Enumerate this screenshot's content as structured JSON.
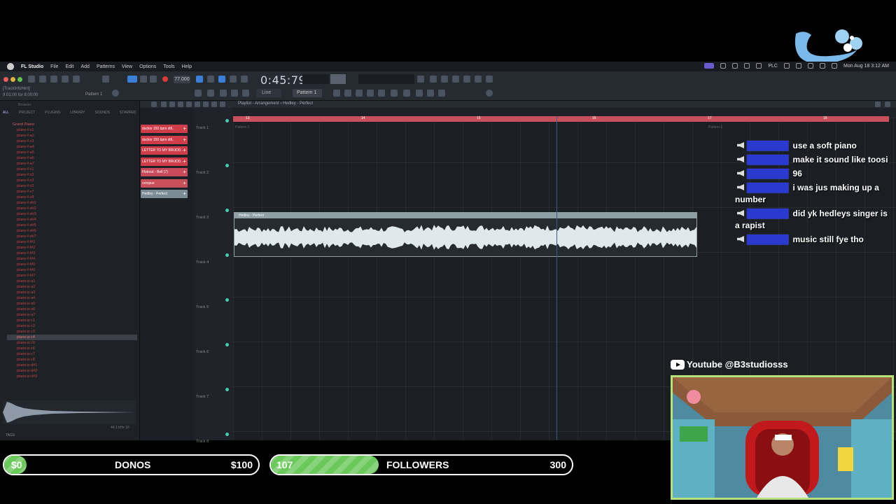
{
  "menubar": {
    "app": "FL Studio",
    "items": [
      "File",
      "Edit",
      "Add",
      "Patterns",
      "View",
      "Options",
      "Tools",
      "Help"
    ],
    "status_text": "PLC",
    "clock": "Mon Aug 18  3:12 AM"
  },
  "toolbar": {
    "tempo": "77.000",
    "time": "0:45:79",
    "snap": "Line",
    "pattern": "Pattern 1",
    "hint_line1": "[TrackInfoHint]",
    "hint_line2": "9:01:00 for 8:00:00",
    "pattern_label": "Pattern 1"
  },
  "browser": {
    "title": "Browser",
    "tabs": [
      "ALL",
      "PROJECT",
      "PLUGINS",
      "LIBRARY",
      "SOUNDS",
      "STARRED"
    ],
    "root": "Grand Piano",
    "items": [
      "piano-f-c1",
      "piano-f-a2",
      "piano-f-c3",
      "piano-f-a4",
      "piano-f-a5",
      "piano-f-a6",
      "piano-f-a7",
      "piano-f-c1",
      "piano-f-c2",
      "piano-f-c3",
      "piano-f-c5",
      "piano-f-c7",
      "piano-f-c8",
      "piano-f-d#1",
      "piano-f-d#2",
      "piano-f-d#3",
      "piano-f-d#4",
      "piano-f-d#5",
      "piano-f-d#6",
      "piano-f-d#7",
      "piano-f-f#1",
      "piano-f-f#2",
      "piano-f-f#3",
      "piano-f-f#4",
      "piano-f-f#5",
      "piano-f-f#6",
      "piano-f-f#7",
      "piano-p-a1",
      "piano-p-a2",
      "piano-p-a3",
      "piano-p-a4",
      "piano-p-a5",
      "piano-p-a6",
      "piano-p-a7",
      "piano-p-c1",
      "piano-p-c2",
      "piano-p-c3",
      "piano-p-c4",
      "piano-p-c5",
      "piano-p-c6",
      "piano-p-c7",
      "piano-p-c8",
      "piano-p-d#1",
      "piano-p-d#2",
      "piano-p-d#3"
    ],
    "selected_index": 37,
    "tags_label": "TAGS",
    "sample_info": "44.1 kHz 16"
  },
  "playlist": {
    "title": "Playlist - Arrangement › Hedley - Perfect",
    "pickers": [
      {
        "label": "duckin 150 bpm dill..",
        "color": "#d03d4a"
      },
      {
        "label": "duckin 150 bpm dill..",
        "color": "#d03d4a"
      },
      {
        "label": "LETTER TO MY BRUDD..",
        "color": "#d03d4a"
      },
      {
        "label": "LETTER TO MY BRUDD..",
        "color": "#d03d4a"
      },
      {
        "label": "Flstrout - Bell (7)",
        "color": "#c94a5b"
      },
      {
        "label": "octopus",
        "color": "#c94f5a"
      },
      {
        "label": "Hedley - Perfect",
        "color": "#7c8c96"
      }
    ],
    "tracks": [
      "Track 1",
      "Track 2",
      "Track 3",
      "Track 4",
      "Track 5",
      "Track 6",
      "Track 7",
      "Track 8"
    ],
    "timeline_ticks": [
      "13",
      "14",
      "15",
      "16",
      "17",
      "18"
    ],
    "pattern_clip_1": "Pattern 1",
    "pattern_clip_2": "Pattern 1",
    "audio_clip": "Hedley - Perfect"
  },
  "chat": [
    {
      "text": "use a soft piano"
    },
    {
      "text": "make it sound like toosi"
    },
    {
      "text": "96"
    },
    {
      "text": "i was jus making up a number"
    },
    {
      "text": "did yk hedleys singer is a rapist"
    },
    {
      "text": "music still fye tho"
    }
  ],
  "youtube": {
    "handle": "Youtube @B3studiosss",
    "icon": "youtube-icon"
  },
  "donos": {
    "current": "$0",
    "label": "DONOS",
    "goal": "$100",
    "progress": 0.0
  },
  "followers": {
    "current": "107",
    "label": "FOLLOWERS",
    "goal": "300",
    "progress": 0.357
  },
  "colors": {
    "accent_green": "#6bc85b",
    "cam_border": "#b6e27a",
    "timeline": "#c94f5a"
  }
}
